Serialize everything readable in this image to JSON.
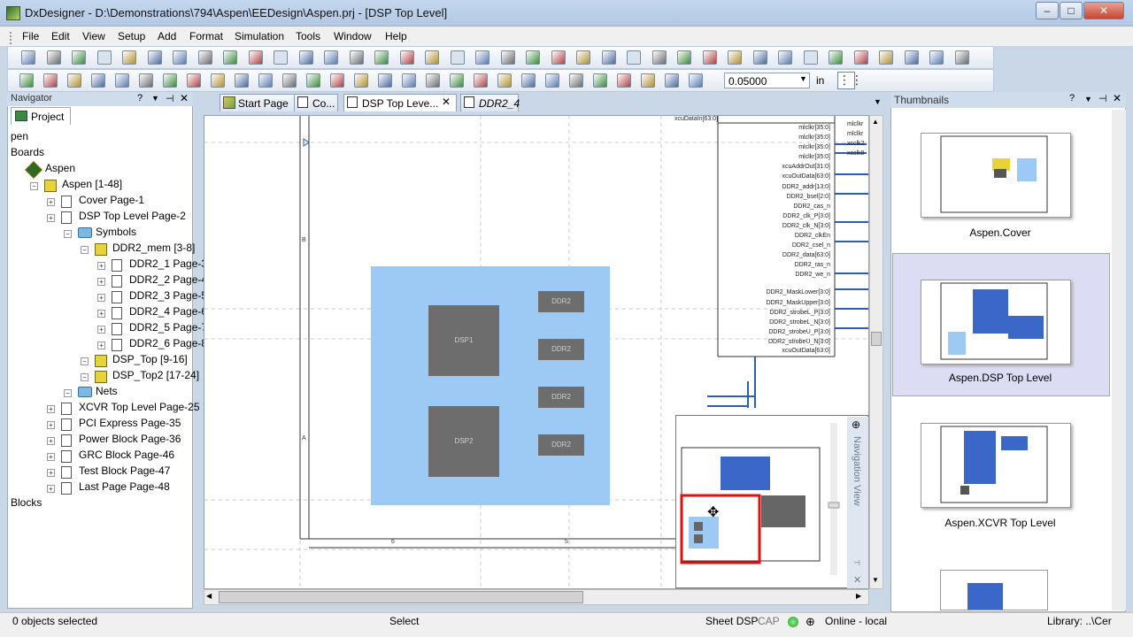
{
  "window": {
    "title": "DxDesigner - D:\\Demonstrations\\794\\Aspen\\EEDesign\\Aspen.prj - [DSP Top Level]"
  },
  "menu": [
    "File",
    "Edit",
    "View",
    "Setup",
    "Add",
    "Format",
    "Simulation",
    "Tools",
    "Window",
    "Help"
  ],
  "toolbar": {
    "zoom_value": "0.05000",
    "zoom_unit": "in"
  },
  "navigator": {
    "title": "Navigator",
    "tab": "Project",
    "items": [
      {
        "label": "pen",
        "indent": 0,
        "icon": "none"
      },
      {
        "label": "Boards",
        "indent": 0,
        "icon": "none"
      },
      {
        "label": "Aspen",
        "indent": 1,
        "icon": "board"
      },
      {
        "label": "Aspen [1-48]",
        "indent": 2,
        "icon": "sym"
      },
      {
        "label": "Cover  Page-1",
        "indent": 3,
        "icon": "doc"
      },
      {
        "label": "DSP Top Level Page-2",
        "indent": 3,
        "icon": "doc"
      },
      {
        "label": "Symbols",
        "indent": 4,
        "icon": "fold"
      },
      {
        "label": "DDR2_mem [3-8]",
        "indent": 5,
        "icon": "sym"
      },
      {
        "label": "DDR2_1 Page-3",
        "indent": 6,
        "icon": "doc"
      },
      {
        "label": "DDR2_2 Page-4",
        "indent": 6,
        "icon": "doc"
      },
      {
        "label": "DDR2_3 Page-5",
        "indent": 6,
        "icon": "doc"
      },
      {
        "label": "DDR2_4 Page-6",
        "indent": 6,
        "icon": "doc"
      },
      {
        "label": "DDR2_5 Page-7",
        "indent": 6,
        "icon": "doc"
      },
      {
        "label": "DDR2_6 Page-8",
        "indent": 6,
        "icon": "doc"
      },
      {
        "label": "DSP_Top [9-16]",
        "indent": 5,
        "icon": "sym"
      },
      {
        "label": "DSP_Top2 [17-24]",
        "indent": 5,
        "icon": "sym"
      },
      {
        "label": "Nets",
        "indent": 4,
        "icon": "fold"
      },
      {
        "label": "XCVR Top Level Page-25",
        "indent": 3,
        "icon": "doc"
      },
      {
        "label": "PCI Express Page-35",
        "indent": 3,
        "icon": "doc"
      },
      {
        "label": "Power Block Page-36",
        "indent": 3,
        "icon": "doc"
      },
      {
        "label": "GRC Block Page-46",
        "indent": 3,
        "icon": "doc"
      },
      {
        "label": "Test Block Page-47",
        "indent": 3,
        "icon": "doc"
      },
      {
        "label": "Last Page Page-48",
        "indent": 3,
        "icon": "doc"
      },
      {
        "label": "Blocks",
        "indent": 0,
        "icon": "none"
      }
    ]
  },
  "tabs": [
    "Start Page",
    "Co...",
    "DSP Top Leve...",
    "DDR2_4"
  ],
  "schematic": {
    "dsp_blocks": [
      "DSP1",
      "DSP2"
    ],
    "ddr_blocks": [
      "DDR2",
      "DDR2",
      "DDR2",
      "DDR2"
    ],
    "pins": [
      "xcuDataIn[63:0]",
      "mlclkr[35:0]",
      "mlclkr[35:0]",
      "mlclkr[35:0]",
      "mlclkr[35:0]",
      "xcuAddrOut[31:0]",
      "xcuOutData[63:0]",
      "DDR2_addr[13:0]",
      "DDR2_bsel[2:0]",
      "DDR2_cas_n",
      "DDR2_clk_P[3:0]",
      "DDR2_clk_N[3:0]",
      "DDR2_clkEn",
      "DDR2_csel_n",
      "DDR2_data[63:0]",
      "DDR2_ras_n",
      "DDR2_we_n",
      "DDR2_MaskLower[3:0]",
      "DDR2_MaskUpper[3:0]",
      "DDR2_strobeL_P[3:0]",
      "DDR2_strobeL_N[3:0]",
      "DDR2_strobeU_P[3:0]",
      "DDR2_strobeU_N[3:0]",
      "xcuOutData[63:0]"
    ],
    "right_pins": [
      "mlclkr",
      "mlclkr",
      "xcclk2",
      "xcclk0"
    ],
    "zone_letters": [
      "B",
      "A"
    ],
    "zone_numbers": [
      "6",
      "5"
    ]
  },
  "nav_view": {
    "label": "Navigation View"
  },
  "thumbnails": {
    "title": "Thumbnails",
    "items": [
      "Aspen.Cover",
      "Aspen.DSP Top Level",
      "Aspen.XCVR Top Level"
    ]
  },
  "status": {
    "selected": "0 objects selected",
    "mode": "Select",
    "sheet": "Sheet DSP",
    "caps": "CAP",
    "online": "Online - local",
    "library": "Library: ..\\Cer"
  }
}
